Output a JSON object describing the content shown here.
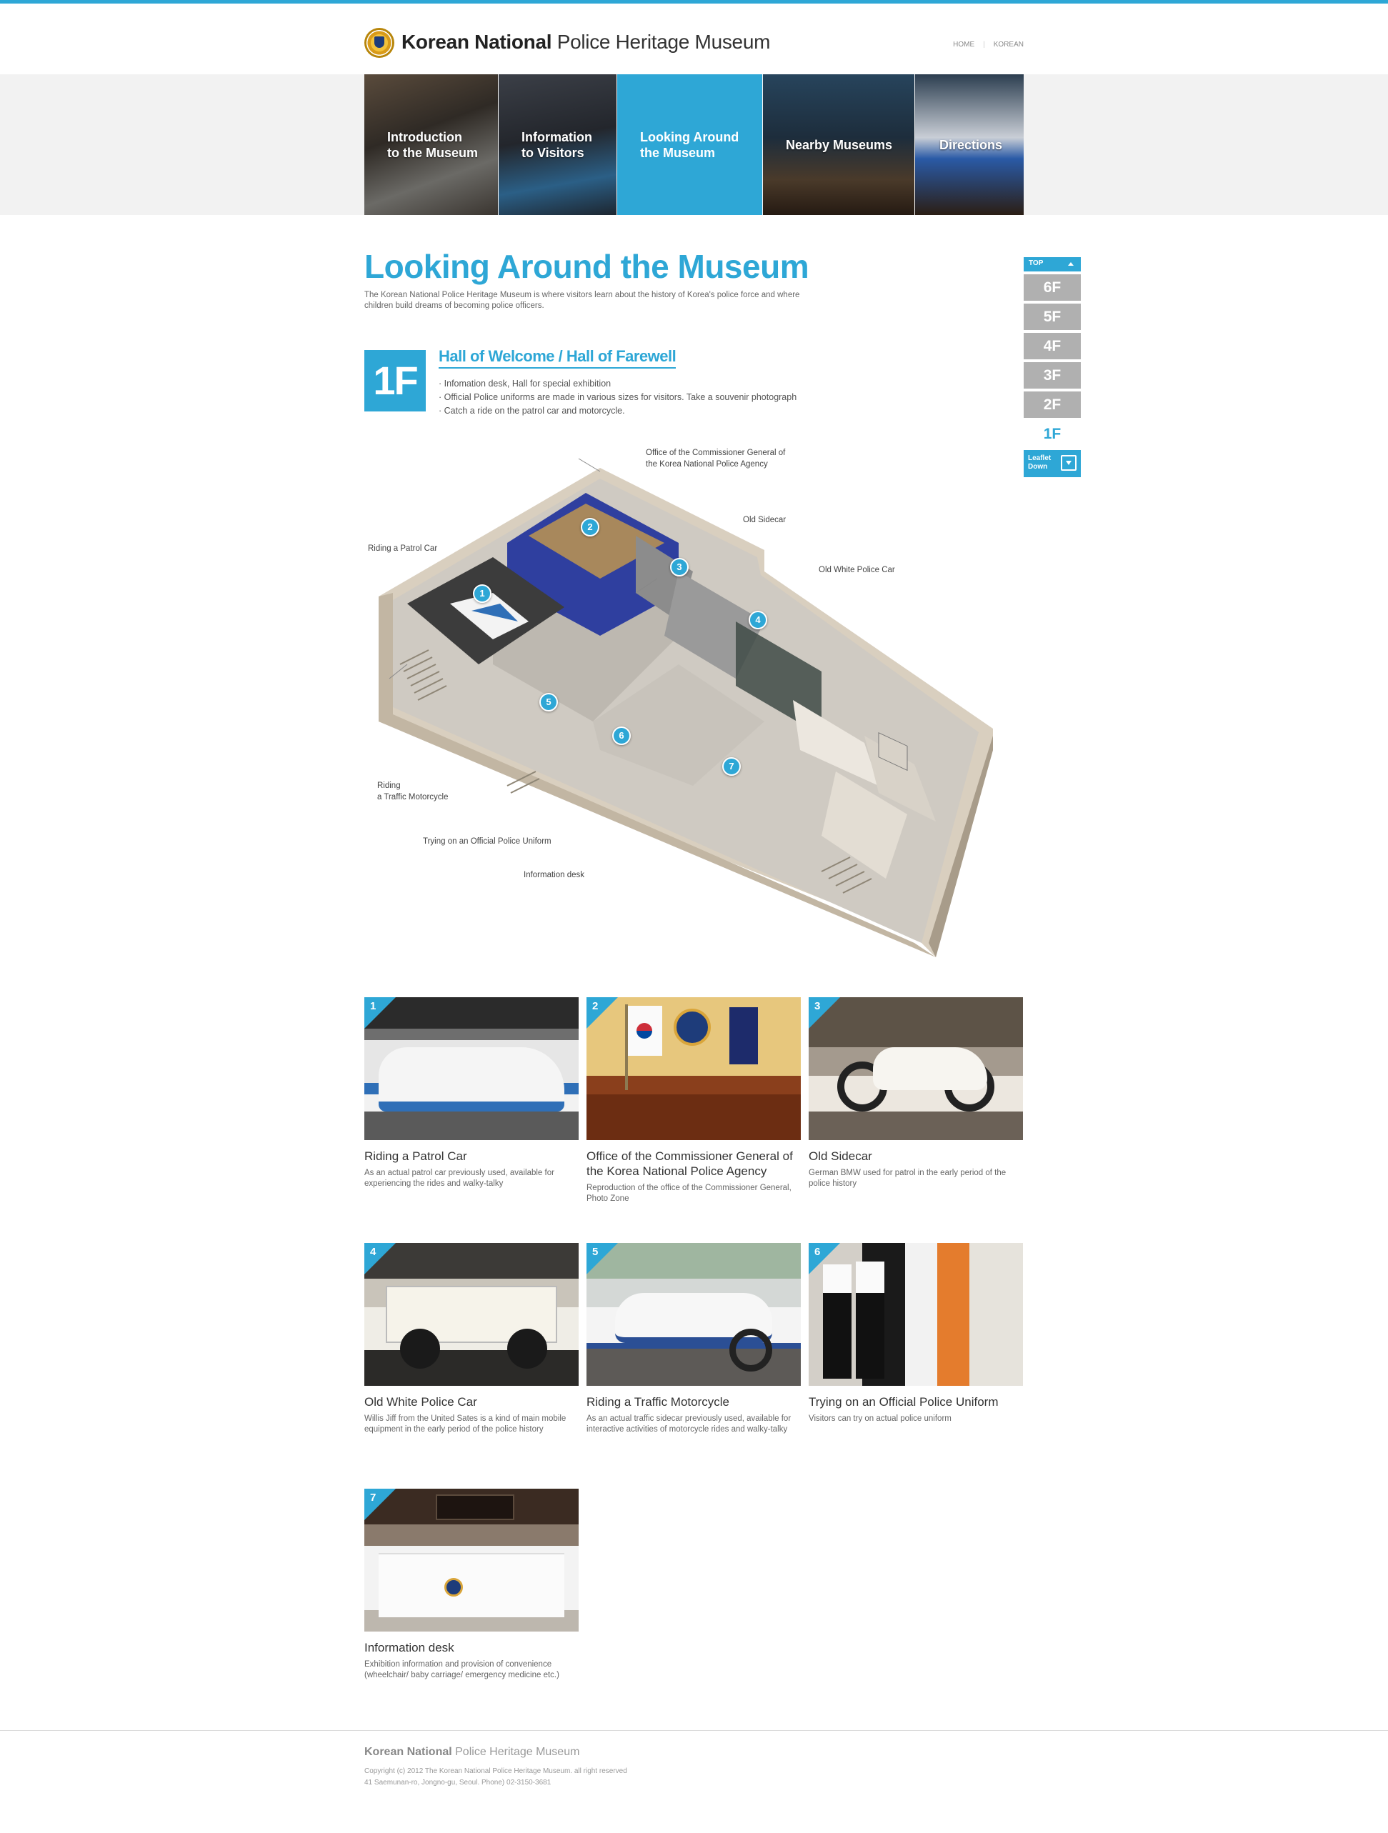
{
  "header": {
    "logo_bold": "Korean National",
    "logo_rest": " Police Heritage Museum",
    "util_home": "HOME",
    "util_korean": "KOREAN"
  },
  "nav": [
    {
      "label": "Introduction\nto the Museum"
    },
    {
      "label": "Information\nto Visitors"
    },
    {
      "label": "Looking Around\nthe Museum",
      "active": true
    },
    {
      "label": "Nearby Museums"
    },
    {
      "label": "Directions"
    }
  ],
  "page": {
    "title": "Looking Around the Museum",
    "desc": "The Korean National Police Heritage Museum is where visitors learn about the history of Korea's police force and where children build dreams of becoming police officers."
  },
  "floor_nav": {
    "top": "TOP",
    "floors": [
      "6F",
      "5F",
      "4F",
      "3F",
      "2F",
      "1F"
    ],
    "active": "1F",
    "leaflet": "Leaflet\nDown"
  },
  "floor": {
    "badge": "1F",
    "title": "Hall of Welcome / Hall of Farewell",
    "items": [
      "Infomation desk, Hall for special exhibition",
      "Official Police uniforms are made in various sizes for visitors. Take a souvenir photograph",
      "Catch a ride on the patrol car and motorcycle."
    ]
  },
  "map": {
    "callouts": {
      "commissioner": "Office of the Commissioner General of\nthe Korea National Police Agency",
      "sidecar": "Old Sidecar",
      "white_car": "Old White Police Car",
      "patrol_car": "Riding a Patrol Car",
      "motorcycle": "Riding\na Traffic Motorcycle",
      "uniform": "Trying on an Official Police Uniform",
      "info_desk": "Information desk"
    },
    "pins": [
      "1",
      "2",
      "3",
      "4",
      "5",
      "6",
      "7"
    ]
  },
  "cards": [
    {
      "num": "1",
      "title": "Riding a Patrol Car",
      "desc": "As an actual patrol car previously used, available for experiencing the rides and walky-talky"
    },
    {
      "num": "2",
      "title": "Office of the Commissioner General of the Korea National Police Agency",
      "desc": "Reproduction of the office of the Commissioner General, Photo Zone"
    },
    {
      "num": "3",
      "title": "Old Sidecar",
      "desc": "German BMW used for patrol in the early period of the police history"
    },
    {
      "num": "4",
      "title": "Old White Police Car",
      "desc": "Willis Jiff from the United Sates is a kind of main mobile equipment in the early period of the police history"
    },
    {
      "num": "5",
      "title": "Riding a Traffic Motorcycle",
      "desc": "As an actual traffic sidecar previously used, available for interactive activities of motorcycle rides and walky-talky"
    },
    {
      "num": "6",
      "title": "Trying on an Official Police Uniform",
      "desc": "Visitors can try on actual police uniform"
    },
    {
      "num": "7",
      "title": "Information desk",
      "desc": "Exhibition information and provision of convenience (wheelchair/ baby carriage/ emergency medicine etc.)"
    }
  ],
  "footer": {
    "logo_bold": "Korean National",
    "logo_rest": " Police Heritage Museum",
    "copy": "Copyright (c) 2012 The Korean National Police Heritage Museum. all right reserved\n41 Saemunan-ro, Jongno-gu, Seoul. Phone) 02-3150-3681"
  },
  "colors": {
    "accent": "#2ea7d6",
    "inactive_floor": "#b0b0b0"
  }
}
